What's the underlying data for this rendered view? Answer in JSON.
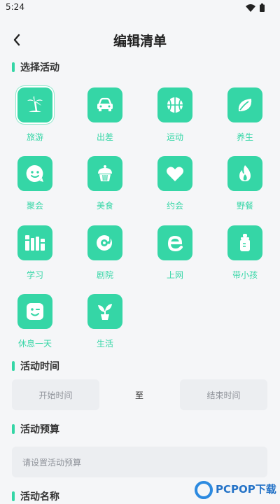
{
  "status": {
    "time": "5:24",
    "icons": [
      "wifi-icon",
      "battery-icon"
    ]
  },
  "header": {
    "title": "编辑清单",
    "back_icon": "chevron-left-icon"
  },
  "sections": {
    "activity": "选择活动",
    "time": "活动时间",
    "budget": "活动预算",
    "name": "活动名称"
  },
  "activities": [
    {
      "label": "旅游",
      "icon": "palm-tree-icon",
      "selected": true
    },
    {
      "label": "出差",
      "icon": "car-icon"
    },
    {
      "label": "运动",
      "icon": "basketball-icon"
    },
    {
      "label": "养生",
      "icon": "leaf-icon"
    },
    {
      "label": "聚会",
      "icon": "smile-chat-icon"
    },
    {
      "label": "美食",
      "icon": "cupcake-icon"
    },
    {
      "label": "约会",
      "icon": "heart-icon"
    },
    {
      "label": "野餐",
      "icon": "flame-icon"
    },
    {
      "label": "学习",
      "icon": "books-icon"
    },
    {
      "label": "剧院",
      "icon": "music-disc-icon"
    },
    {
      "label": "上网",
      "icon": "browser-e-icon"
    },
    {
      "label": "带小孩",
      "icon": "baby-bottle-icon"
    },
    {
      "label": "休息一天",
      "icon": "wink-face-icon"
    },
    {
      "label": "生活",
      "icon": "sprout-icon"
    }
  ],
  "time": {
    "start_placeholder": "开始时间",
    "separator": "至",
    "end_placeholder": "结束时间"
  },
  "budget": {
    "placeholder": "请设置活动预算"
  },
  "watermark": {
    "text": "PCPOP下载"
  },
  "colors": {
    "accent": "#35d6a6",
    "background": "#f5f6f8",
    "field": "#eceef1"
  }
}
